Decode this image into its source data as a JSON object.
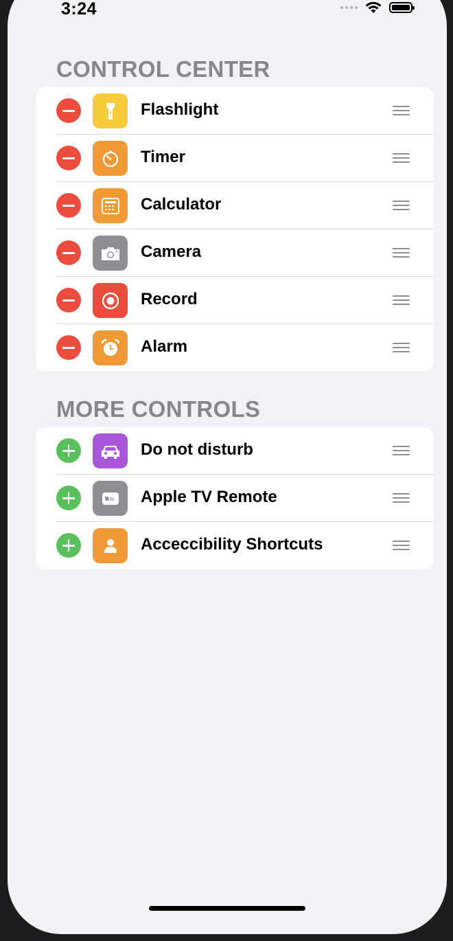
{
  "status_bar": {
    "time": "3:24"
  },
  "sections": [
    {
      "header": "CONTROL CENTER",
      "action": "remove",
      "items": [
        {
          "label": "Flashlight",
          "icon": "flashlight-icon",
          "color": "#f8cc3c"
        },
        {
          "label": "Timer",
          "icon": "timer-icon",
          "color": "#f19a38"
        },
        {
          "label": "Calculator",
          "icon": "calculator-icon",
          "color": "#f19a38"
        },
        {
          "label": "Camera",
          "icon": "camera-icon",
          "color": "#8e8e93"
        },
        {
          "label": "Record",
          "icon": "record-icon",
          "color": "#ea4c3d"
        },
        {
          "label": "Alarm",
          "icon": "alarm-icon",
          "color": "#f19a38"
        }
      ]
    },
    {
      "header": "MORE CONTROLS",
      "action": "add",
      "items": [
        {
          "label": "Do not disturb",
          "icon": "car-icon",
          "color": "#a957d8"
        },
        {
          "label": "Apple TV Remote",
          "icon": "apple-tv-icon",
          "color": "#8e8e93"
        },
        {
          "label": "Acceccibility Shortcuts",
          "icon": "person-icon",
          "color": "#f19a38"
        }
      ]
    }
  ],
  "colors": {
    "remove": "#ea4c3d",
    "add": "#5ac05c",
    "background": "#f2f1f6"
  }
}
